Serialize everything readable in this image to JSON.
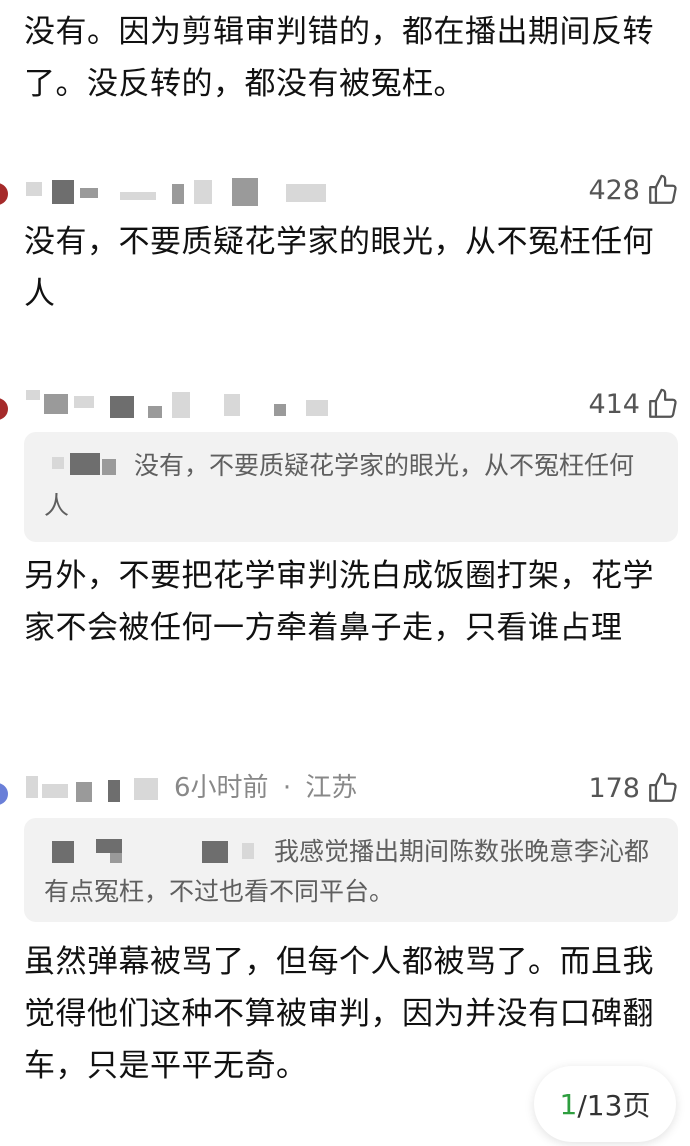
{
  "top_text": "没有。因为剪辑审判错的，都在播出期间反转了。没反转的，都没有被冤枉。",
  "comments": [
    {
      "likes": "428",
      "body": "没有，不要质疑花学家的眼光，从不冤枉任何人"
    },
    {
      "likes": "414",
      "quote": "没有，不要质疑花学家的眼光，从不冤枉任何人",
      "body": "另外，不要把花学审判洗白成饭圈打架，花学家不会被任何一方牵着鼻子走，只看谁占理"
    },
    {
      "time": "6小时前",
      "separator": "·",
      "location": "江苏",
      "likes": "178",
      "quote": "我感觉播出期间陈数张晚意李沁都有点冤枉，不过也看不同平台。",
      "body": "虽然弹幕被骂了，但每个人都被骂了。而且我觉得他们这种不算被审判，因为并没有口碑翻车，只是平平无奇。"
    }
  ],
  "pagination": {
    "current": "1",
    "suffix": "/13页"
  },
  "colors": {
    "accent_green": "#2e9e3f",
    "avatar_red": "#a52a2a",
    "avatar_blue": "#6a7fd8"
  },
  "icons": {
    "like": "thumbs-up-icon"
  }
}
